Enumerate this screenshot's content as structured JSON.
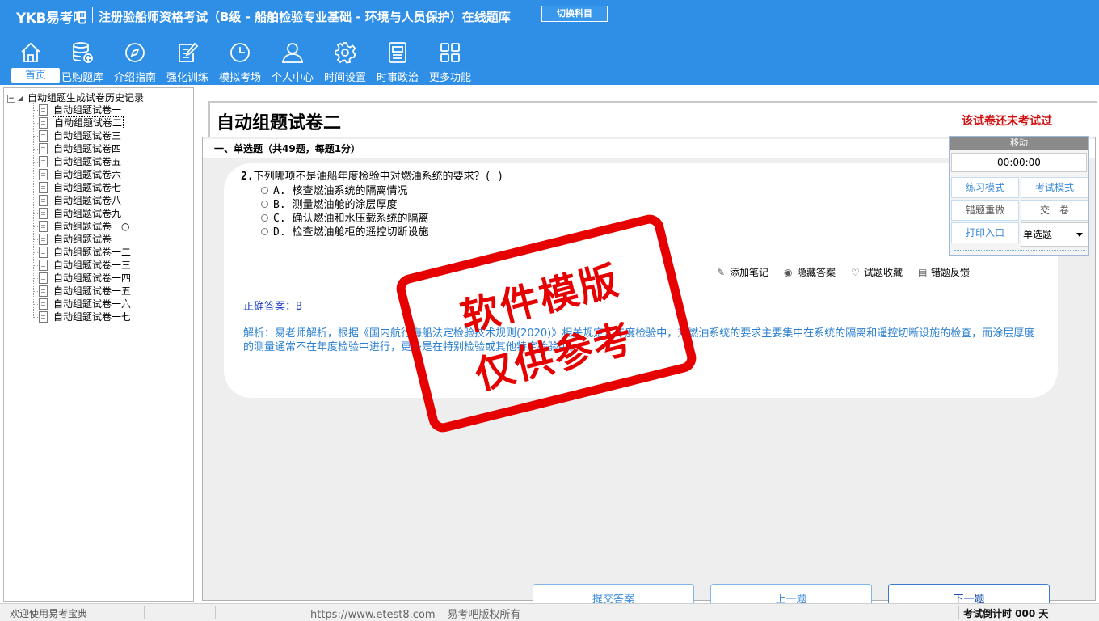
{
  "header": {
    "brand": "YKB易考吧",
    "title": "注册验船师资格考试（B级 - 船舶检验专业基础 - 环境与人员保护）在线题库",
    "switch_label": "切换科目",
    "bg_color": "#2f8fe6"
  },
  "nav": {
    "items": [
      {
        "label": "首页",
        "icon": "home-icon"
      },
      {
        "label": "已购题库",
        "icon": "database-add-icon"
      },
      {
        "label": "介绍指南",
        "icon": "compass-icon"
      },
      {
        "label": "强化训练",
        "icon": "edit-icon"
      },
      {
        "label": "模拟考场",
        "icon": "clock-icon"
      },
      {
        "label": "个人中心",
        "icon": "user-icon"
      },
      {
        "label": "时间设置",
        "icon": "gear-icon"
      },
      {
        "label": "时事政治",
        "icon": "news-icon"
      },
      {
        "label": "更多功能",
        "icon": "grid-icon"
      }
    ]
  },
  "tree": {
    "root": "自动组题生成试卷历史记录",
    "items": [
      "自动组题试卷一",
      "自动组题试卷二",
      "自动组题试卷三",
      "自动组题试卷四",
      "自动组题试卷五",
      "自动组题试卷六",
      "自动组题试卷七",
      "自动组题试卷八",
      "自动组题试卷九",
      "自动组题试卷一○",
      "自动组题试卷一一",
      "自动组题试卷一二",
      "自动组题试卷一三",
      "自动组题试卷一四",
      "自动组题试卷一五",
      "自动组题试卷一六",
      "自动组题试卷一七"
    ],
    "selected_index": 1
  },
  "exam": {
    "title": "自动组题试卷二",
    "status": "该试卷还未考试过",
    "status_color": "#d01010",
    "section": "一、单选题（共49题，每题1分）"
  },
  "question": {
    "number": "2.",
    "text": "下列哪项不是油船年度检验中对燃油系统的要求？( )",
    "options": [
      "A. 核查燃油系统的隔离情况",
      "B. 测量燃油舱的涂层厚度",
      "C. 确认燃油和水压载系统的隔离",
      "D. 检查燃油舱柜的遥控切断设施"
    ],
    "tools": [
      {
        "label": "添加笔记",
        "icon": "pencil-icon"
      },
      {
        "label": "隐藏答案",
        "icon": "eye-icon"
      },
      {
        "label": "试题收藏",
        "icon": "heart-icon"
      },
      {
        "label": "错题反馈",
        "icon": "feedback-icon"
      }
    ],
    "answer_label": "正确答案：",
    "answer_value": "B",
    "analysis": "解析：易老师解析，根据《国内航行海船法定检验技术规则(2020)》相关规定，年度检验中，对燃油系统的要求主要集中在系统的隔离和遥控切断设施的检查，而涂层厚度的测量通常不在年度检验中进行，更多是在特别检验或其他特定检验中。"
  },
  "buttons": {
    "submit": "提交答案",
    "prev": "上一题",
    "next": "下一题"
  },
  "panel": {
    "head": "移动",
    "timer": "00:00:00",
    "practice": "练习模式",
    "exam": "考试模式",
    "redo": "错题重做",
    "hand_in": "交　卷",
    "print": "打印入口",
    "type_select": "单选题"
  },
  "watermark": {
    "line1": "软件模版",
    "line2": "仅供参考"
  },
  "statusbar": {
    "welcome": "欢迎使用易考宝典",
    "url": "https://www.etest8.com – 易考吧版权所有",
    "countdown": "考试倒计时 000 天"
  }
}
